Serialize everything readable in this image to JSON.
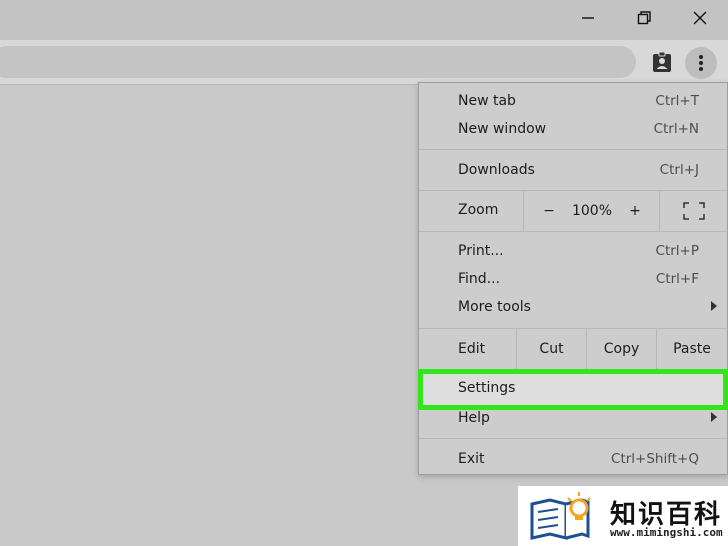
{
  "window_controls": {
    "minimize_icon": "minimize-icon",
    "restore_icon": "restore-icon",
    "close_icon": "close-icon"
  },
  "menu": {
    "new_tab": {
      "label": "New tab",
      "shortcut": "Ctrl+T"
    },
    "new_window": {
      "label": "New window",
      "shortcut": "Ctrl+N"
    },
    "downloads": {
      "label": "Downloads",
      "shortcut": "Ctrl+J"
    },
    "zoom": {
      "label": "Zoom",
      "minus": "−",
      "value": "100%",
      "plus": "+"
    },
    "print": {
      "label": "Print...",
      "shortcut": "Ctrl+P"
    },
    "find": {
      "label": "Find...",
      "shortcut": "Ctrl+F"
    },
    "more_tools": {
      "label": "More tools"
    },
    "edit": {
      "label": "Edit",
      "cut": "Cut",
      "copy": "Copy",
      "paste": "Paste"
    },
    "settings": {
      "label": "Settings"
    },
    "help": {
      "label": "Help"
    },
    "exit": {
      "label": "Exit",
      "shortcut": "Ctrl+Shift+Q"
    }
  },
  "highlight_color": "#33e51d",
  "logo": {
    "text": "知识百科",
    "url": "www.mimingshi.com"
  }
}
